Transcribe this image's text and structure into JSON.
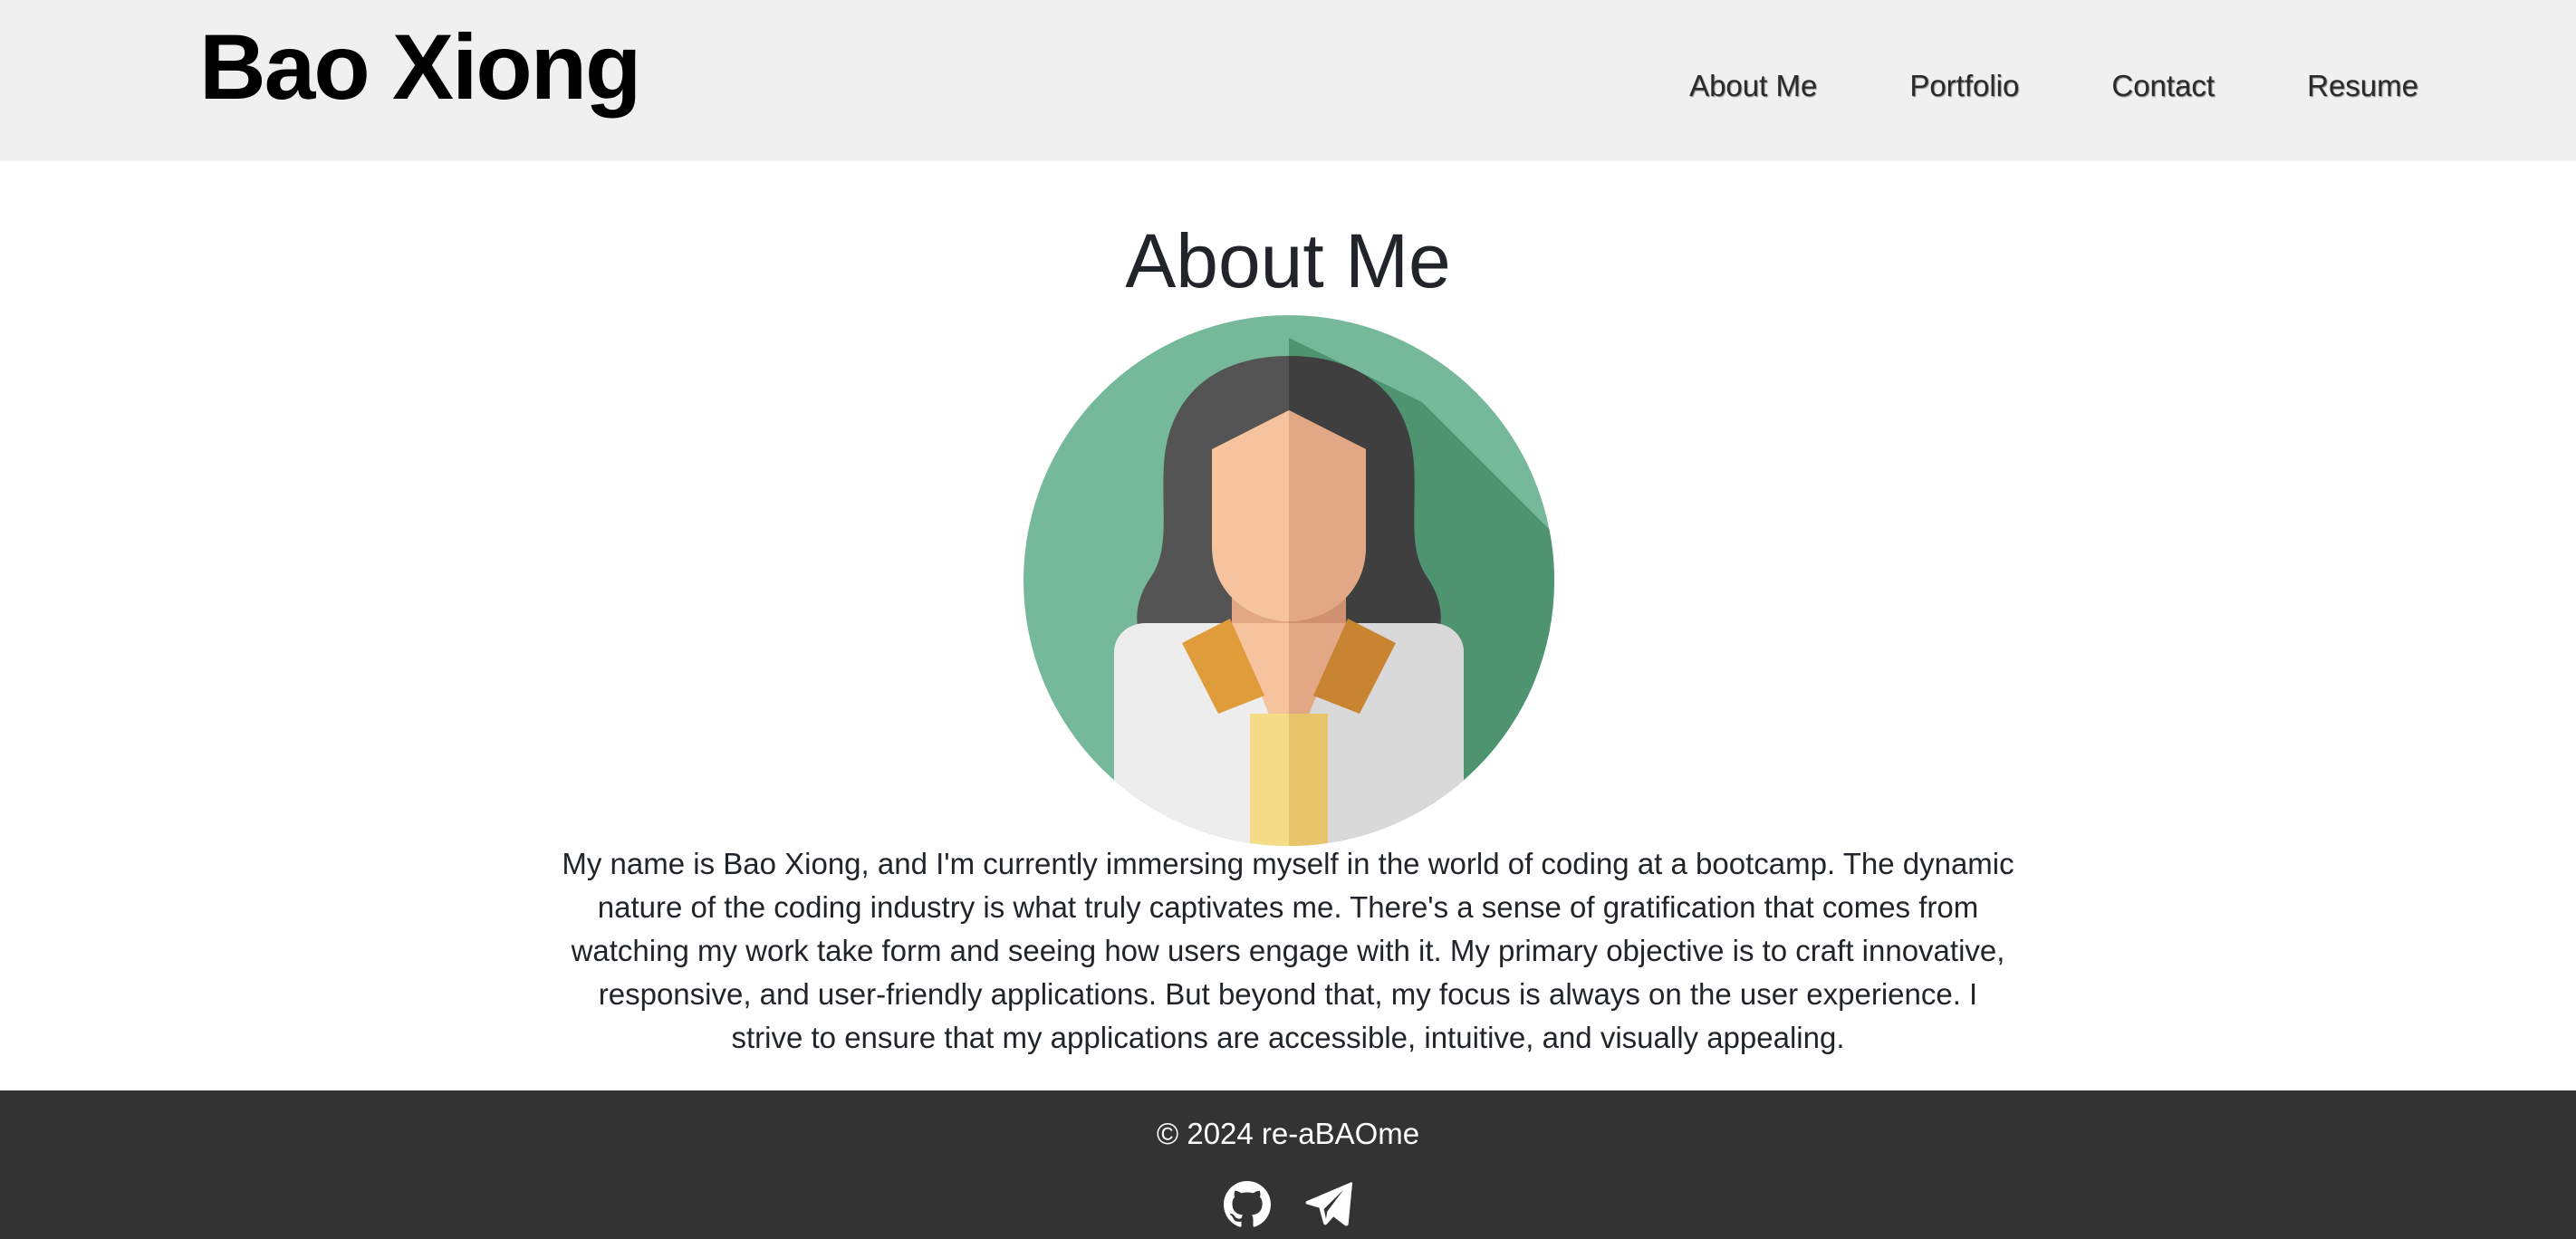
{
  "header": {
    "brand": "Bao Xiong",
    "nav": [
      {
        "label": "About Me"
      },
      {
        "label": "Portfolio"
      },
      {
        "label": "Contact"
      },
      {
        "label": "Resume"
      }
    ]
  },
  "about": {
    "title": "About Me",
    "avatar_icon": "woman-avatar-illustration",
    "bio": "My name is Bao Xiong, and I'm currently immersing myself in the world of coding at a bootcamp. The dynamic nature of the coding industry is what truly captivates me. There's a sense of gratification that comes from watching my work take form and seeing how users engage with it. My primary objective is to craft innovative, responsive, and user-friendly applications. But beyond that, my focus is always on the user experience. I strive to ensure that my applications are accessible, intuitive, and visually appealing."
  },
  "footer": {
    "copyright": "© 2024 re-aBAOme",
    "social": [
      {
        "icon": "github-icon"
      },
      {
        "icon": "paper-plane-icon"
      }
    ]
  },
  "colors": {
    "header_bg": "#f0f0f0",
    "footer_bg": "#333333",
    "avatar_bg": "#76b99a"
  }
}
